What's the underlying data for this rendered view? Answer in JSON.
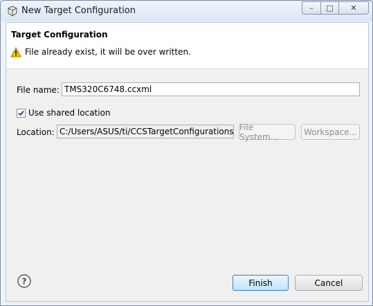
{
  "window": {
    "title": "New Target Configuration",
    "controls": {
      "minimize": "–",
      "maximize": "□",
      "close": "✕"
    }
  },
  "banner": {
    "title": "Target Configuration",
    "message": "File already exist, it will be over written."
  },
  "form": {
    "file_name_label": "File name:",
    "file_name_value": "TMS320C6748.ccxml",
    "use_shared_label": "Use shared location",
    "use_shared_checked": true,
    "location_label": "Location:",
    "location_value": "C:/Users/ASUS/ti/CCSTargetConfigurations",
    "file_system_button": "File System...",
    "workspace_button": "Workspace..."
  },
  "footer": {
    "finish_label": "Finish",
    "cancel_label": "Cancel"
  },
  "icons": {
    "app": "eclipse-cube-icon",
    "warning": "warning-icon",
    "help": "help-icon"
  },
  "colors": {
    "warning": "#f2c200",
    "default_button_border": "#3c7fb1"
  }
}
